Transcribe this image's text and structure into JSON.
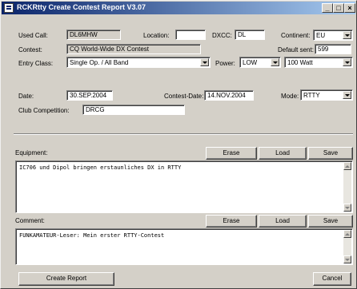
{
  "window": {
    "title": "RCKRtty Create Contest Report V3.07",
    "minimize": "_",
    "maximize": "□",
    "close": "×"
  },
  "form": {
    "used_call": {
      "label": "Used Call:",
      "value": "DL6MHW"
    },
    "location": {
      "label": "Location:",
      "value": ""
    },
    "dxcc": {
      "label": "DXCC:",
      "value": "DL"
    },
    "continent": {
      "label": "Continent:",
      "value": "EU"
    },
    "contest": {
      "label": "Contest:",
      "value": "CQ World-Wide DX Contest"
    },
    "default_sent": {
      "label": "Default sent:",
      "value": "599"
    },
    "entry_class": {
      "label": "Entry Class:",
      "value": "Single Op. / All Band"
    },
    "power": {
      "label": "Power:",
      "value": "LOW",
      "watt": "100 Watt"
    },
    "date": {
      "label": "Date:",
      "value": "30.SEP.2004"
    },
    "contest_date": {
      "label": "Contest-Date:",
      "value": "14.NOV.2004"
    },
    "mode": {
      "label": "Mode:",
      "value": "RTTY"
    },
    "club": {
      "label": "Club Competition:",
      "value": "DRCG"
    }
  },
  "equipment": {
    "label": "Equipment:",
    "erase": "Erase",
    "load": "Load",
    "save": "Save",
    "text": "IC706 und Dipol bringen erstaunliches DX in RTTY"
  },
  "comment": {
    "label": "Comment:",
    "erase": "Erase",
    "load": "Load",
    "save": "Save",
    "text": "FUNKAMATEUR-Leser: Mein erster RTTY-Contest"
  },
  "footer": {
    "create": "Create Report",
    "cancel": "Cancel"
  }
}
